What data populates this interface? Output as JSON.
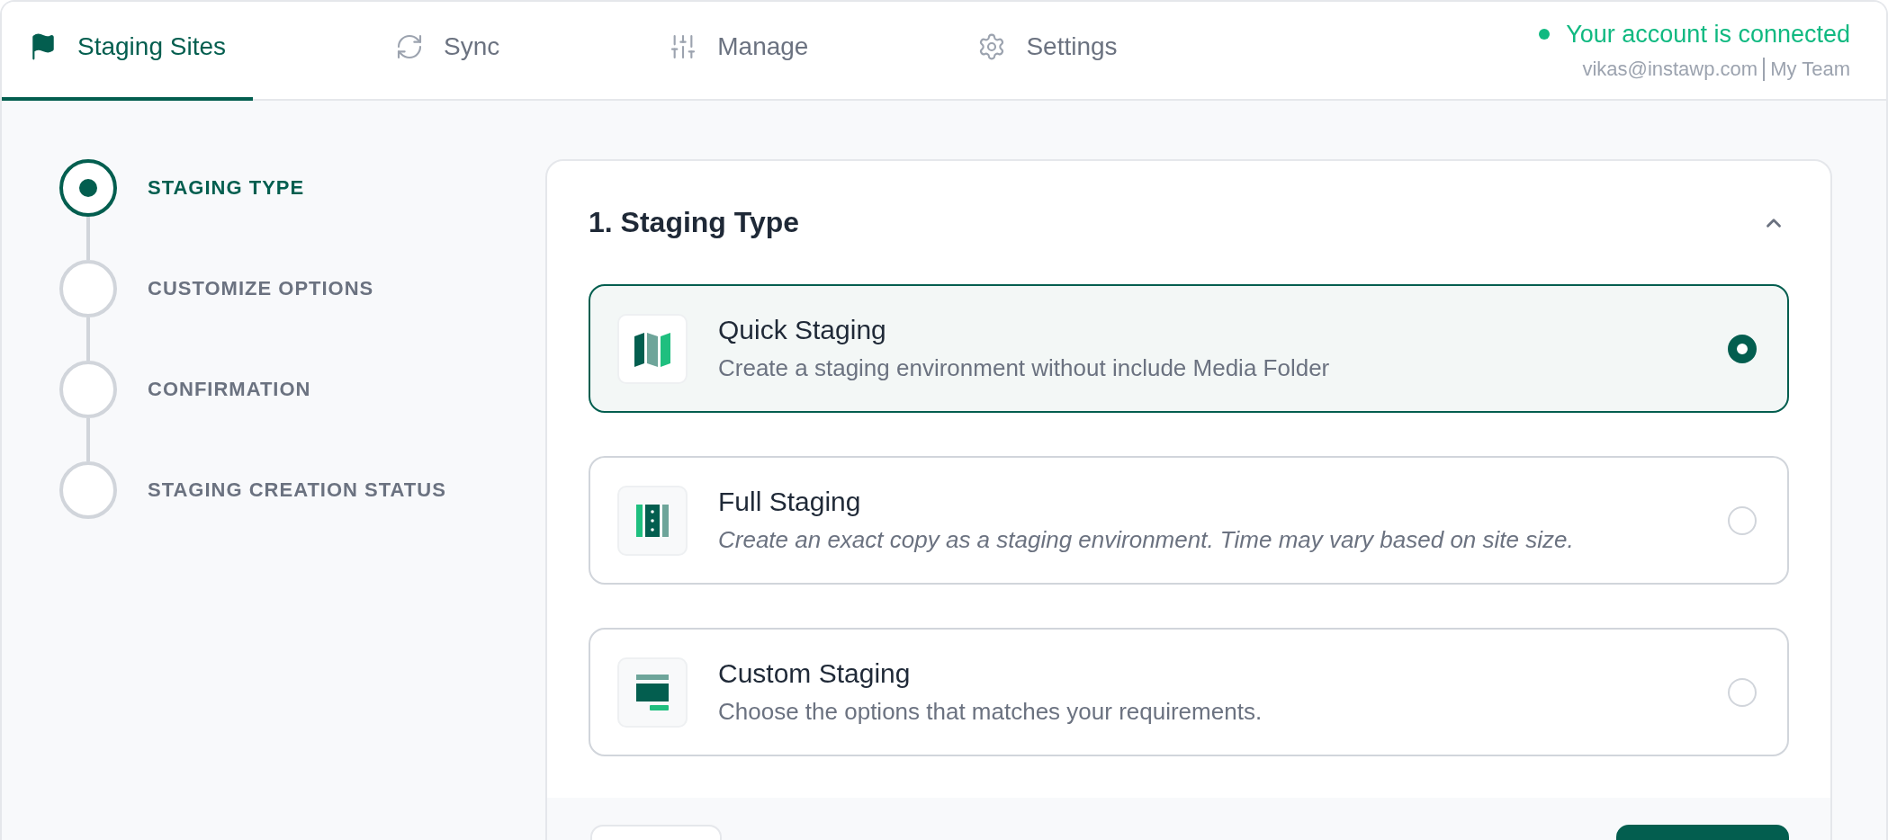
{
  "tabs": [
    {
      "kind": "flag",
      "label": "Staging Sites",
      "selected": true
    },
    {
      "kind": "sync",
      "label": "Sync",
      "selected": false
    },
    {
      "kind": "sliders",
      "label": "Manage",
      "selected": false
    },
    {
      "kind": "gear",
      "label": "Settings",
      "selected": false
    }
  ],
  "account": {
    "connected": true,
    "status": "Your account is connected",
    "email": "vikas@instawp.com",
    "team": "My Team"
  },
  "steps": [
    {
      "label": "STAGING TYPE",
      "selected": true
    },
    {
      "label": "CUSTOMIZE OPTIONS",
      "selected": false
    },
    {
      "label": "CONFIRMATION",
      "selected": false
    },
    {
      "label": "STAGING CREATION STATUS",
      "selected": false
    }
  ],
  "panel": {
    "title": "1. Staging Type",
    "expanded": true,
    "options": [
      {
        "kind": "quick",
        "title": "Quick Staging",
        "description": "Create a staging environment without include Media Folder",
        "italic": false,
        "selected": true
      },
      {
        "kind": "full",
        "title": "Full Staging",
        "description": "Create an exact copy as a staging environment. Time may vary based on site size.",
        "italic": true,
        "selected": false
      },
      {
        "kind": "custom",
        "title": "Custom Staging",
        "description": "Choose the options that matches your requirements.",
        "italic": false,
        "selected": false
      }
    ],
    "footer_buttons": [
      {
        "kind": "secondary"
      },
      {
        "kind": "primary"
      }
    ]
  }
}
